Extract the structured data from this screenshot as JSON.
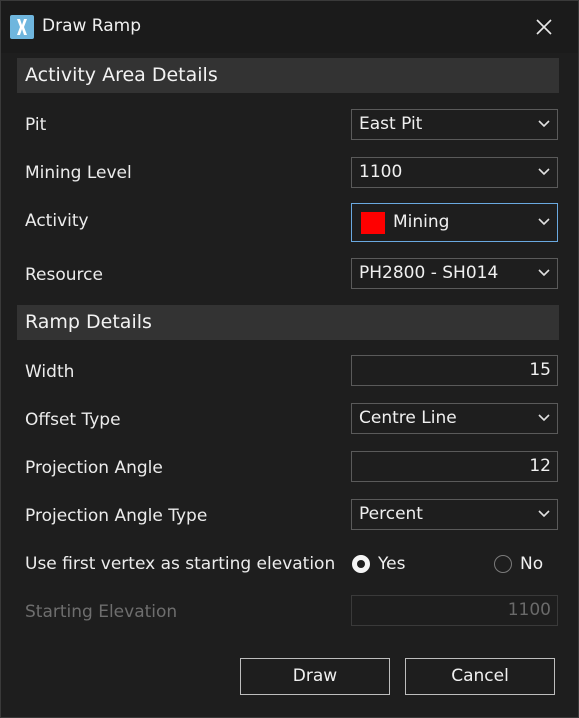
{
  "window": {
    "title": "Draw Ramp"
  },
  "sections": {
    "activity": "Activity Area Details",
    "ramp": "Ramp Details"
  },
  "fields": {
    "pit": {
      "label": "Pit",
      "value": "East Pit"
    },
    "mining_level": {
      "label": "Mining Level",
      "value": "1100"
    },
    "activity": {
      "label": "Activity",
      "value": "Mining",
      "swatch_color": "#ff0000"
    },
    "resource": {
      "label": "Resource",
      "value": "PH2800 - SH014"
    },
    "width": {
      "label": "Width",
      "value": "15"
    },
    "offset_type": {
      "label": "Offset Type",
      "value": "Centre Line"
    },
    "projection_angle": {
      "label": "Projection Angle",
      "value": "12"
    },
    "projection_angle_type": {
      "label": "Projection Angle Type",
      "value": "Percent"
    },
    "use_first_vertex": {
      "label": "Use first vertex as starting elevation",
      "yes": "Yes",
      "no": "No",
      "selected": "Yes"
    },
    "starting_elevation": {
      "label": "Starting Elevation",
      "value": "1100",
      "disabled": true
    }
  },
  "buttons": {
    "draw": "Draw",
    "cancel": "Cancel"
  },
  "colors": {
    "accent_focus": "#6aa9e0",
    "app_icon": "#6fb6de",
    "background": "#1e1e1e",
    "section_header": "#333333"
  }
}
